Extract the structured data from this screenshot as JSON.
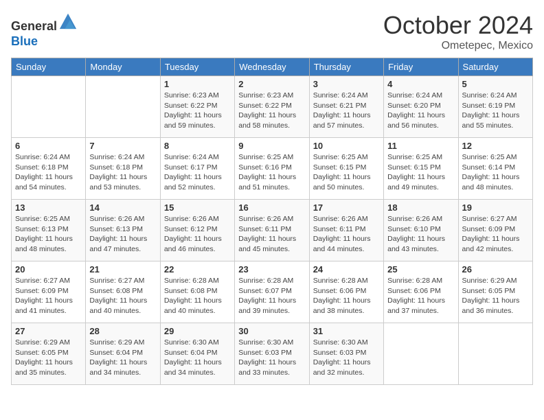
{
  "header": {
    "logo_line1": "General",
    "logo_line2": "Blue",
    "month": "October 2024",
    "location": "Ometepec, Mexico"
  },
  "days_of_week": [
    "Sunday",
    "Monday",
    "Tuesday",
    "Wednesday",
    "Thursday",
    "Friday",
    "Saturday"
  ],
  "weeks": [
    [
      {
        "day": "",
        "info": ""
      },
      {
        "day": "",
        "info": ""
      },
      {
        "day": "1",
        "info": "Sunrise: 6:23 AM\nSunset: 6:22 PM\nDaylight: 11 hours and 59 minutes."
      },
      {
        "day": "2",
        "info": "Sunrise: 6:23 AM\nSunset: 6:22 PM\nDaylight: 11 hours and 58 minutes."
      },
      {
        "day": "3",
        "info": "Sunrise: 6:24 AM\nSunset: 6:21 PM\nDaylight: 11 hours and 57 minutes."
      },
      {
        "day": "4",
        "info": "Sunrise: 6:24 AM\nSunset: 6:20 PM\nDaylight: 11 hours and 56 minutes."
      },
      {
        "day": "5",
        "info": "Sunrise: 6:24 AM\nSunset: 6:19 PM\nDaylight: 11 hours and 55 minutes."
      }
    ],
    [
      {
        "day": "6",
        "info": "Sunrise: 6:24 AM\nSunset: 6:18 PM\nDaylight: 11 hours and 54 minutes."
      },
      {
        "day": "7",
        "info": "Sunrise: 6:24 AM\nSunset: 6:18 PM\nDaylight: 11 hours and 53 minutes."
      },
      {
        "day": "8",
        "info": "Sunrise: 6:24 AM\nSunset: 6:17 PM\nDaylight: 11 hours and 52 minutes."
      },
      {
        "day": "9",
        "info": "Sunrise: 6:25 AM\nSunset: 6:16 PM\nDaylight: 11 hours and 51 minutes."
      },
      {
        "day": "10",
        "info": "Sunrise: 6:25 AM\nSunset: 6:15 PM\nDaylight: 11 hours and 50 minutes."
      },
      {
        "day": "11",
        "info": "Sunrise: 6:25 AM\nSunset: 6:15 PM\nDaylight: 11 hours and 49 minutes."
      },
      {
        "day": "12",
        "info": "Sunrise: 6:25 AM\nSunset: 6:14 PM\nDaylight: 11 hours and 48 minutes."
      }
    ],
    [
      {
        "day": "13",
        "info": "Sunrise: 6:25 AM\nSunset: 6:13 PM\nDaylight: 11 hours and 48 minutes."
      },
      {
        "day": "14",
        "info": "Sunrise: 6:26 AM\nSunset: 6:13 PM\nDaylight: 11 hours and 47 minutes."
      },
      {
        "day": "15",
        "info": "Sunrise: 6:26 AM\nSunset: 6:12 PM\nDaylight: 11 hours and 46 minutes."
      },
      {
        "day": "16",
        "info": "Sunrise: 6:26 AM\nSunset: 6:11 PM\nDaylight: 11 hours and 45 minutes."
      },
      {
        "day": "17",
        "info": "Sunrise: 6:26 AM\nSunset: 6:11 PM\nDaylight: 11 hours and 44 minutes."
      },
      {
        "day": "18",
        "info": "Sunrise: 6:26 AM\nSunset: 6:10 PM\nDaylight: 11 hours and 43 minutes."
      },
      {
        "day": "19",
        "info": "Sunrise: 6:27 AM\nSunset: 6:09 PM\nDaylight: 11 hours and 42 minutes."
      }
    ],
    [
      {
        "day": "20",
        "info": "Sunrise: 6:27 AM\nSunset: 6:09 PM\nDaylight: 11 hours and 41 minutes."
      },
      {
        "day": "21",
        "info": "Sunrise: 6:27 AM\nSunset: 6:08 PM\nDaylight: 11 hours and 40 minutes."
      },
      {
        "day": "22",
        "info": "Sunrise: 6:28 AM\nSunset: 6:08 PM\nDaylight: 11 hours and 40 minutes."
      },
      {
        "day": "23",
        "info": "Sunrise: 6:28 AM\nSunset: 6:07 PM\nDaylight: 11 hours and 39 minutes."
      },
      {
        "day": "24",
        "info": "Sunrise: 6:28 AM\nSunset: 6:06 PM\nDaylight: 11 hours and 38 minutes."
      },
      {
        "day": "25",
        "info": "Sunrise: 6:28 AM\nSunset: 6:06 PM\nDaylight: 11 hours and 37 minutes."
      },
      {
        "day": "26",
        "info": "Sunrise: 6:29 AM\nSunset: 6:05 PM\nDaylight: 11 hours and 36 minutes."
      }
    ],
    [
      {
        "day": "27",
        "info": "Sunrise: 6:29 AM\nSunset: 6:05 PM\nDaylight: 11 hours and 35 minutes."
      },
      {
        "day": "28",
        "info": "Sunrise: 6:29 AM\nSunset: 6:04 PM\nDaylight: 11 hours and 34 minutes."
      },
      {
        "day": "29",
        "info": "Sunrise: 6:30 AM\nSunset: 6:04 PM\nDaylight: 11 hours and 34 minutes."
      },
      {
        "day": "30",
        "info": "Sunrise: 6:30 AM\nSunset: 6:03 PM\nDaylight: 11 hours and 33 minutes."
      },
      {
        "day": "31",
        "info": "Sunrise: 6:30 AM\nSunset: 6:03 PM\nDaylight: 11 hours and 32 minutes."
      },
      {
        "day": "",
        "info": ""
      },
      {
        "day": "",
        "info": ""
      }
    ]
  ]
}
